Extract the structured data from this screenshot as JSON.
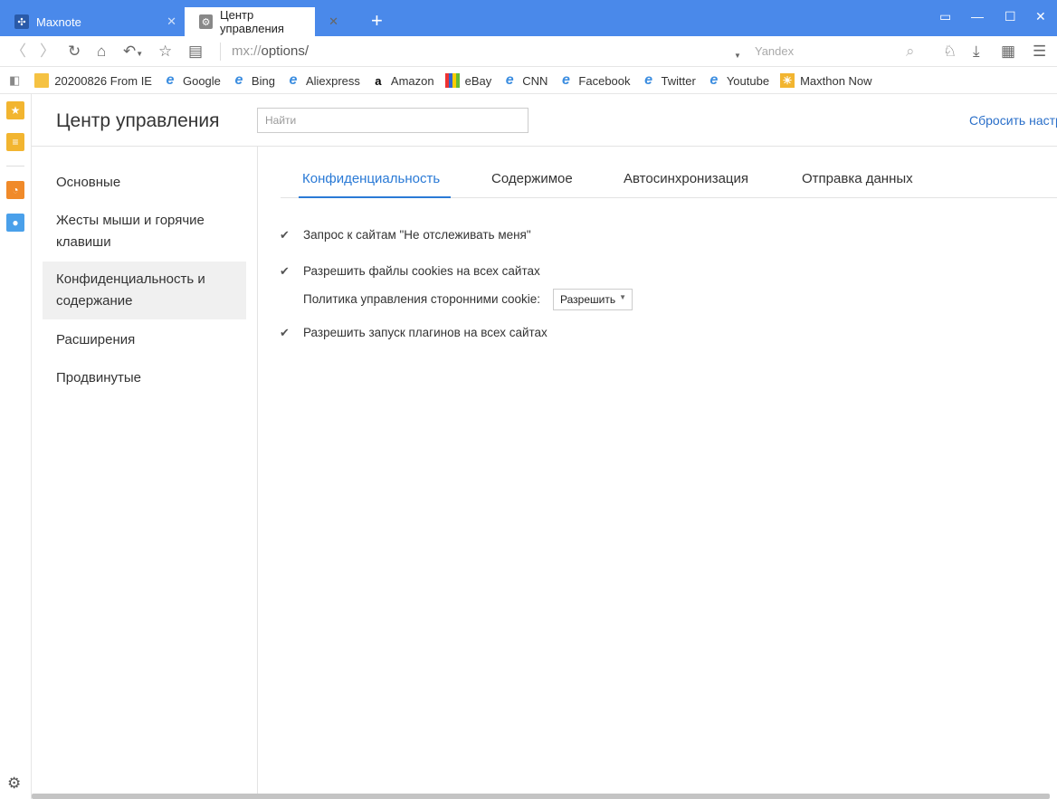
{
  "tabs": [
    {
      "title": "Maxnote",
      "icon": "maxnote-icon"
    },
    {
      "title": "Центр управления",
      "icon": "gear-icon"
    }
  ],
  "toolbar": {
    "url_prefix": "mx://",
    "url_path": "options/",
    "search_placeholder": "Yandex"
  },
  "bookmarks": [
    {
      "label": "20200826 From IE",
      "icon": "folder-icon"
    },
    {
      "label": "Google",
      "icon": "ie-icon"
    },
    {
      "label": "Bing",
      "icon": "ie-icon"
    },
    {
      "label": "Aliexpress",
      "icon": "ie-icon"
    },
    {
      "label": "Amazon",
      "icon": "amazon-icon"
    },
    {
      "label": "eBay",
      "icon": "ebay-icon"
    },
    {
      "label": "CNN",
      "icon": "ie-icon"
    },
    {
      "label": "Facebook",
      "icon": "ie-icon"
    },
    {
      "label": "Twitter",
      "icon": "ie-icon"
    },
    {
      "label": "Youtube",
      "icon": "ie-icon"
    },
    {
      "label": "Maxthon Now",
      "icon": "sun-icon"
    }
  ],
  "header": {
    "title": "Центр управления",
    "find_placeholder": "Найти",
    "reset_link": "Сбросить настр"
  },
  "nav": [
    {
      "label": "Основные"
    },
    {
      "label": "Жесты мыши и горячие клавиши"
    },
    {
      "label": "Конфиденциальность и содержание",
      "selected": true
    },
    {
      "label": "Расширения"
    },
    {
      "label": "Продвинутые"
    }
  ],
  "subtabs": [
    {
      "label": "Конфиденциальность",
      "active": true
    },
    {
      "label": "Содержимое"
    },
    {
      "label": "Автосинхронизация"
    },
    {
      "label": "Отправка данных"
    }
  ],
  "options": {
    "dnt": {
      "label": "Запрос к сайтам \"Не отслеживать меня\"",
      "checked": true
    },
    "cookies": {
      "label": "Разрешить файлы cookies на всех сайтах",
      "checked": true
    },
    "third_party_label": "Политика управления сторонними cookie:",
    "third_party_value": "Разрешить",
    "plugins": {
      "label": "Разрешить запуск плагинов на всех сайтах",
      "checked": true
    }
  },
  "colors": {
    "titlebar": "#4a89ea",
    "accent": "#2a7ad6"
  }
}
